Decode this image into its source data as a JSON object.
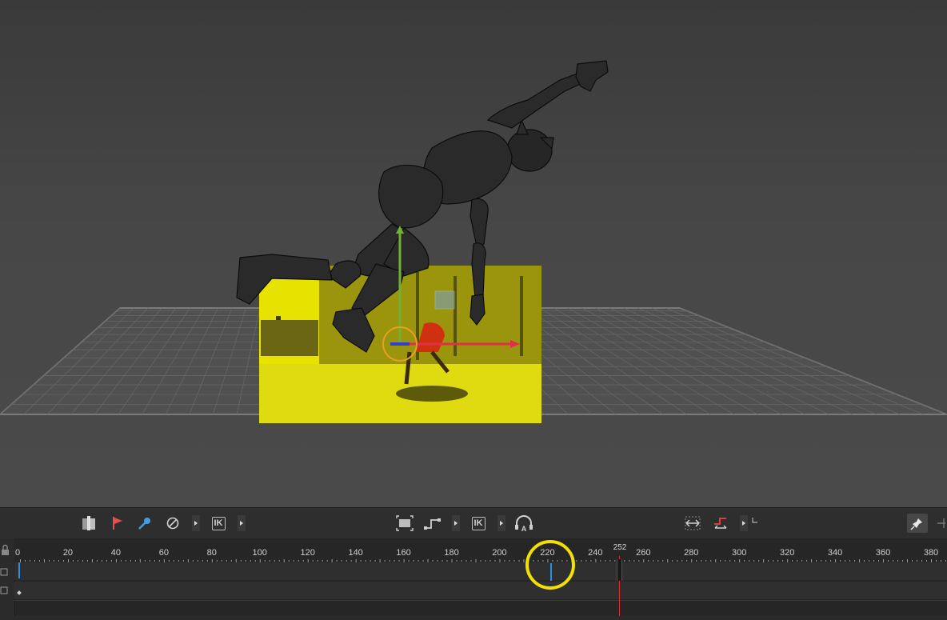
{
  "timeline": {
    "ticks": [
      "0",
      "20",
      "40",
      "60",
      "80",
      "100",
      "120",
      "140",
      "160",
      "180",
      "200",
      "220",
      "240",
      "260",
      "280",
      "300",
      "320",
      "340",
      "360",
      "380"
    ],
    "current_frame": "252"
  },
  "toolbar": {
    "ik_label_1": "IK",
    "ik_label_2": "IK",
    "auto_label": "A"
  },
  "colors": {
    "highlight_circle": "#f2e000",
    "playhead": "#d83030",
    "key_marker": "#2a8fe0",
    "plane": "#e4e000"
  }
}
